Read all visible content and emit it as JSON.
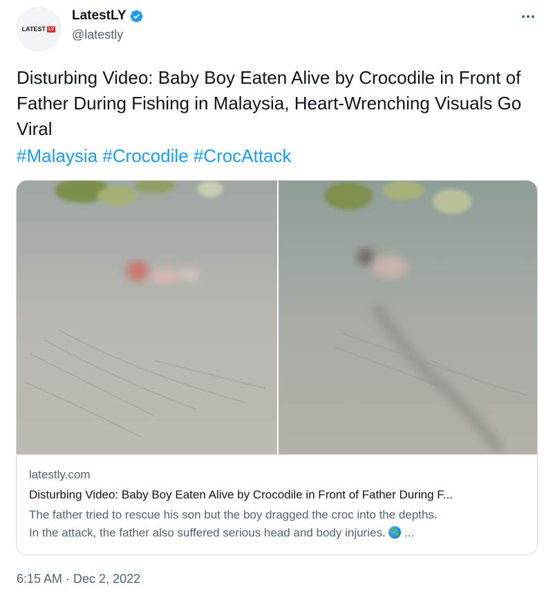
{
  "account": {
    "display_name": "LatestLY",
    "handle": "@latestly",
    "verified": true,
    "logo_text": "LATEST",
    "logo_box": "LY"
  },
  "tweet": {
    "text": "Disturbing Video: Baby Boy Eaten Alive by Crocodile in Front of Father During Fishing in Malaysia, Heart-Wrenching Visuals Go Viral",
    "hashtags": [
      "#Malaysia",
      "#Crocodile",
      "#CrocAttack"
    ],
    "timestamp": "6:15 AM · Dec 2, 2022"
  },
  "link_card": {
    "domain": "latestly.com",
    "title": "Disturbing Video: Baby Boy Eaten Alive by Crocodile in Front of Father During F...",
    "description_line1": "The father tried to rescue his son but the boy dragged the croc into the depths.",
    "description_line2": "In the attack, the father also suffered serious head and body injuries.",
    "description_suffix": "...",
    "icon": "globe-emoji"
  },
  "icons": {
    "verified": "verified-badge-icon",
    "more": "more-options-icon"
  },
  "colors": {
    "link": "#1d9bf0",
    "verified": "#1d9bf0",
    "secondary_text": "#536471",
    "border": "#cfd9de"
  }
}
